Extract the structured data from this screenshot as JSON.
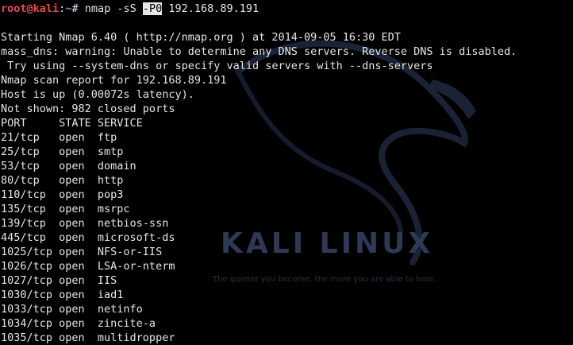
{
  "prompt": {
    "user_host": "root@kali",
    "separator": ":",
    "path": "~",
    "symbol": "#",
    "command_before": " nmap -sS ",
    "command_highlight": "-P0",
    "command_after": " 192.168.89.191"
  },
  "output": {
    "blank": "",
    "starting": "Starting Nmap 6.40 ( http://nmap.org ) at 2014-09-05 16:30 EDT",
    "warning1": "mass_dns: warning: Unable to determine any DNS servers. Reverse DNS is disabled.",
    "warning2": " Try using --system-dns or specify valid servers with --dns-servers",
    "report": "Nmap scan report for 192.168.89.191",
    "host_up": "Host is up (0.00072s latency).",
    "not_shown": "Not shown: 982 closed ports",
    "header": "PORT     STATE SERVICE"
  },
  "ports": [
    {
      "text": "21/tcp   open  ftp"
    },
    {
      "text": "25/tcp   open  smtp"
    },
    {
      "text": "53/tcp   open  domain"
    },
    {
      "text": "80/tcp   open  http"
    },
    {
      "text": "110/tcp  open  pop3"
    },
    {
      "text": "135/tcp  open  msrpc"
    },
    {
      "text": "139/tcp  open  netbios-ssn"
    },
    {
      "text": "445/tcp  open  microsoft-ds"
    },
    {
      "text": "1025/tcp open  NFS-or-IIS"
    },
    {
      "text": "1026/tcp open  LSA-or-nterm"
    },
    {
      "text": "1027/tcp open  IIS"
    },
    {
      "text": "1030/tcp open  iad1"
    },
    {
      "text": "1033/tcp open  netinfo"
    },
    {
      "text": "1034/tcp open  zincite-a"
    },
    {
      "text": "1035/tcp open  multidropper"
    }
  ],
  "watermark": {
    "logo_text": "KALI LINUX",
    "tagline": "The quieter you become, the more you are able to hear."
  },
  "colors": {
    "background": "#000000",
    "text": "#e6e6e6",
    "prompt_user": "#e94b4b",
    "prompt_path": "#6b8fd6"
  }
}
